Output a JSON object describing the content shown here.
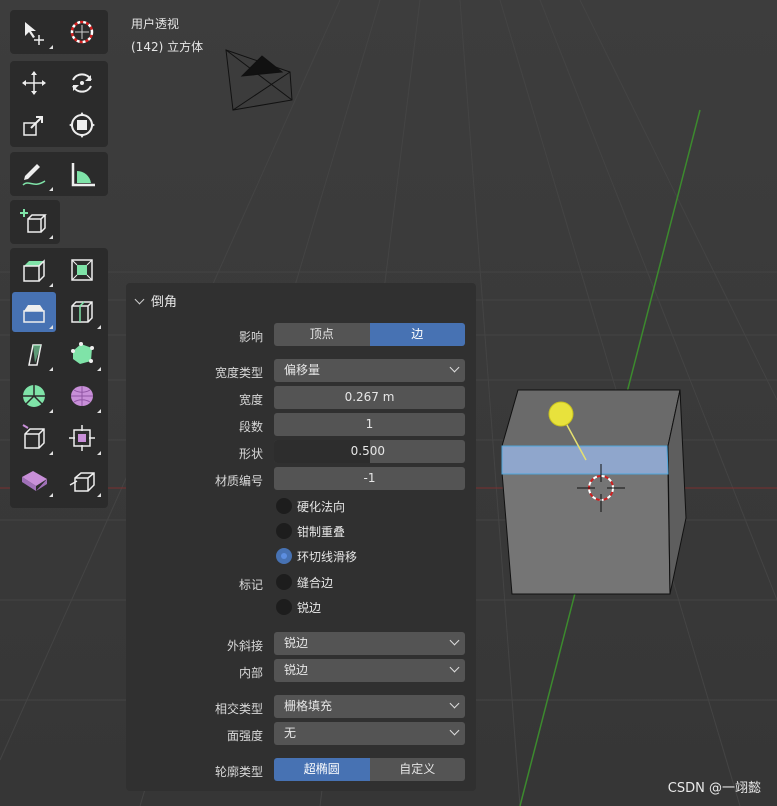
{
  "viewport": {
    "view_name": "用户透视",
    "object_info": "(142) 立方体"
  },
  "toolbar": {
    "tools": [
      {
        "name": "select-tool",
        "icon": "select-move-cursor-icon"
      },
      {
        "name": "cursor-tool",
        "icon": "3d-cursor-icon"
      },
      {
        "name": "move-tool",
        "icon": "move-arrows-icon"
      },
      {
        "name": "rotate-tool",
        "icon": "rotate-icon"
      },
      {
        "name": "scale-tool",
        "icon": "scale-icon"
      },
      {
        "name": "transform-tool",
        "icon": "transform-icon"
      },
      {
        "name": "annotate-tool",
        "icon": "annotate-pencil-icon"
      },
      {
        "name": "measure-tool",
        "icon": "measure-ruler-icon"
      },
      {
        "name": "add-cube-tool",
        "icon": "add-cube-icon"
      },
      {
        "name": "extrude-tool",
        "icon": "extrude-region-icon"
      },
      {
        "name": "inset-tool",
        "icon": "inset-faces-icon"
      },
      {
        "name": "bevel-tool",
        "icon": "bevel-icon",
        "active": true
      },
      {
        "name": "loop-cut-tool",
        "icon": "loop-cut-icon"
      },
      {
        "name": "knife-tool",
        "icon": "knife-icon"
      },
      {
        "name": "poly-build-tool",
        "icon": "poly-build-icon"
      },
      {
        "name": "spin-tool",
        "icon": "spin-icon"
      },
      {
        "name": "smooth-tool",
        "icon": "smooth-vertices-icon"
      },
      {
        "name": "edge-slide-tool",
        "icon": "edge-slide-icon"
      },
      {
        "name": "shrink-fatten-tool",
        "icon": "shrink-fatten-icon"
      },
      {
        "name": "shear-tool",
        "icon": "shear-icon"
      },
      {
        "name": "rip-region-tool",
        "icon": "rip-region-icon"
      }
    ]
  },
  "panel": {
    "title": "倒角",
    "affect_label": "影响",
    "affect_options": [
      "顶点",
      "边"
    ],
    "affect_selected": "边",
    "width_type_label": "宽度类型",
    "width_type_value": "偏移量",
    "width_label": "宽度",
    "width_value": "0.267 m",
    "segments_label": "段数",
    "segments_value": "1",
    "shape_label": "形状",
    "shape_value": "0.500",
    "shape_fraction": 0.5,
    "material_label": "材质编号",
    "material_value": "-1",
    "harden_normals": {
      "label": "硬化法向",
      "checked": false
    },
    "clamp_overlap": {
      "label": "钳制重叠",
      "checked": false
    },
    "loop_slide": {
      "label": "环切线滑移",
      "checked": true
    },
    "mark_label": "标记",
    "mark_seam": {
      "label": "缝合边",
      "checked": false
    },
    "mark_sharp": {
      "label": "锐边",
      "checked": false
    },
    "miter_outer_label": "外斜接",
    "miter_outer_value": "锐边",
    "inner_label": "内部",
    "inner_value": "锐边",
    "intersection_label": "相交类型",
    "intersection_value": "栅格填充",
    "face_strength_label": "面强度",
    "face_strength_value": "无",
    "profile_type_label": "轮廓类型",
    "profile_options": [
      "超椭圆",
      "自定义"
    ],
    "profile_selected": "超椭圆"
  },
  "watermark": "CSDN @一翊懿",
  "colors": {
    "accent": "#4772b3",
    "viewport_bg": "#393939",
    "panel_bg": "#303030",
    "field_bg": "#545454"
  }
}
